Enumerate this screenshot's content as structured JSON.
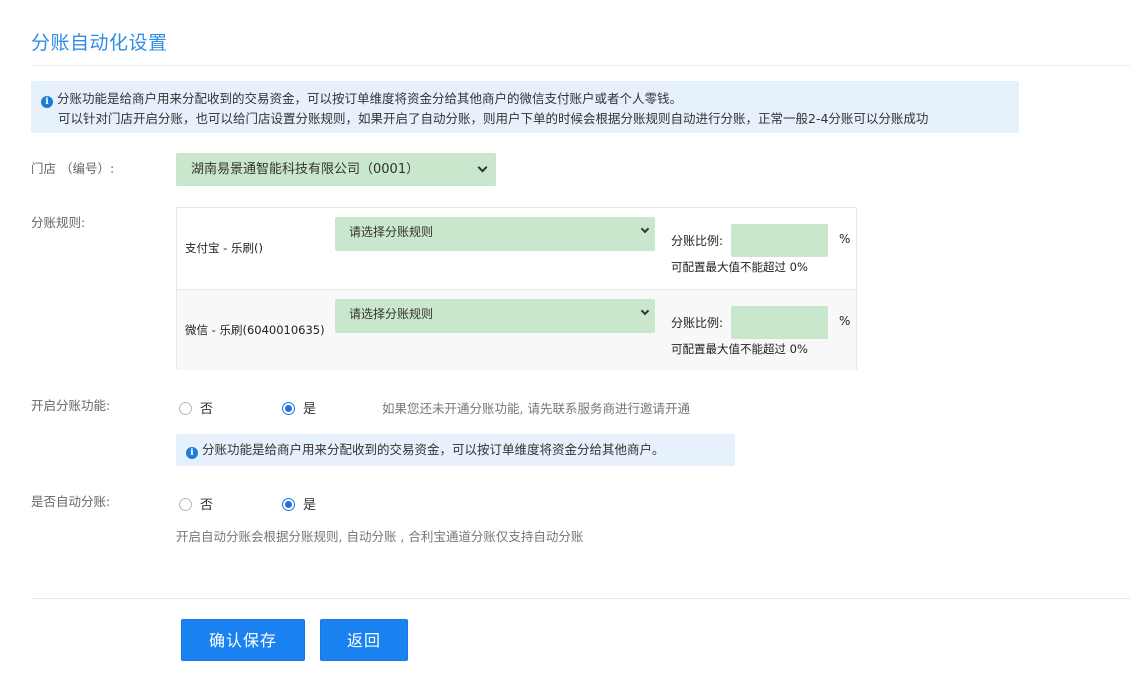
{
  "header": {
    "title": "分账自动化设置"
  },
  "notice": {
    "line1": "分账功能是给商户用来分配收到的交易资金，可以按订单维度将资金分给其他商户的微信支付账户或者个人零钱。",
    "line2": "可以针对门店开启分账，也可以给门店设置分账规则，如果开启了自动分账，则用户下单的时候会根据分账规则自动进行分账，正常一般2-4分账可以分账成功",
    "icon": "info-icon"
  },
  "store": {
    "label": "门店 （编号）:",
    "selected": "湖南易景通智能科技有限公司（0001）"
  },
  "rules": {
    "label": "分账规则:",
    "rows": [
      {
        "channel": "支付宝 - 乐刷()",
        "select_placeholder": "请选择分账规则",
        "ratio_label": "分账比例:",
        "ratio_value": "",
        "pct": "%",
        "max_note": "可配置最大值不能超过 0%"
      },
      {
        "channel": "微信 - 乐刷(6040010635)",
        "select_placeholder": "请选择分账规则",
        "ratio_label": "分账比例:",
        "ratio_value": "",
        "pct": "%",
        "max_note": "可配置最大值不能超过 0%"
      }
    ]
  },
  "enable_split": {
    "label": "开启分账功能:",
    "options": [
      "否",
      "是"
    ],
    "selected": "是",
    "hint": "如果您还未开通分账功能, 请先联系服务商进行邀请开通",
    "notice": "分账功能是给商户用来分配收到的交易资金，可以按订单维度将资金分给其他商户。"
  },
  "auto_split": {
    "label": "是否自动分账:",
    "options": [
      "否",
      "是"
    ],
    "selected": "是",
    "hint": "开启自动分账会根据分账规则, 自动分账 , 合利宝通道分账仅支持自动分账"
  },
  "buttons": {
    "save": "确认保存",
    "back": "返回"
  },
  "colors": {
    "accent": "#1a82f0",
    "title": "#2f8ee4",
    "notice_bg": "#e6f1fc",
    "select_bg": "#c9e7cc"
  }
}
